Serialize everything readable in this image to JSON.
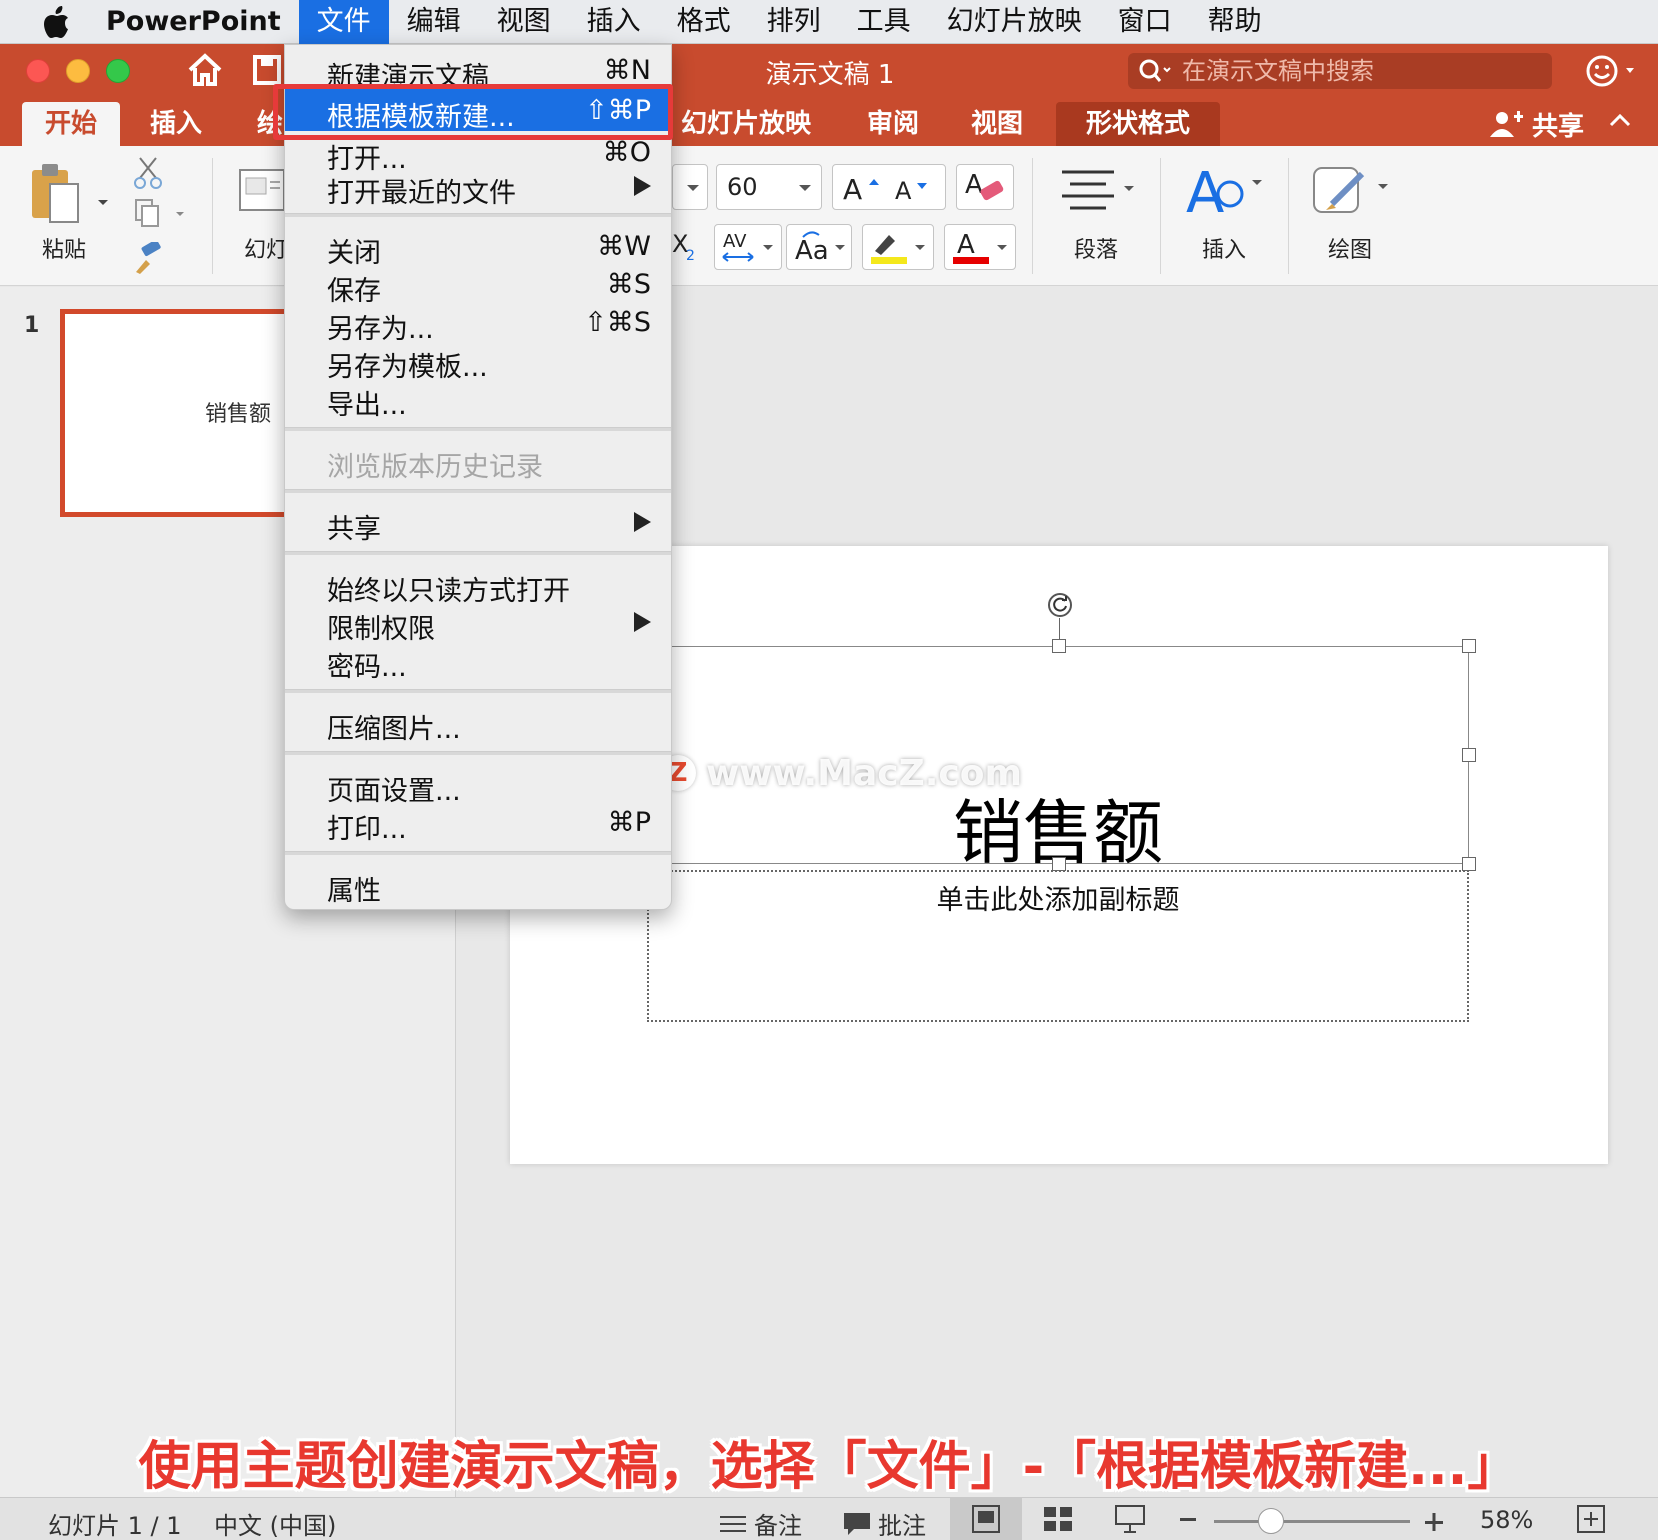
{
  "menubar": {
    "app": "PowerPoint",
    "items": [
      "文件",
      "编辑",
      "视图",
      "插入",
      "格式",
      "排列",
      "工具",
      "幻灯片放映",
      "窗口",
      "帮助"
    ]
  },
  "window": {
    "title": "演示文稿 1",
    "search_placeholder": "在演示文稿中搜索"
  },
  "tabs": {
    "home": "开始",
    "insert": "插入",
    "draw_partial": "绘",
    "slideshow": "幻灯片放映",
    "review": "审阅",
    "view": "视图",
    "shape_format": "形状格式",
    "share": "共享"
  },
  "ribbon": {
    "paste": "粘贴",
    "slides_partial": "幻灯",
    "font_size": "60",
    "paragraph": "段落",
    "insert": "插入",
    "drawing": "绘图"
  },
  "file_menu": {
    "new_presentation": {
      "label": "新建演示文稿",
      "shortcut": "⌘N"
    },
    "new_from_template": {
      "label": "根据模板新建...",
      "shortcut": "⇧⌘P"
    },
    "open": {
      "label": "打开...",
      "shortcut": "⌘O"
    },
    "open_recent": {
      "label": "打开最近的文件"
    },
    "close": {
      "label": "关闭",
      "shortcut": "⌘W"
    },
    "save": {
      "label": "保存",
      "shortcut": "⌘S"
    },
    "save_as": {
      "label": "另存为...",
      "shortcut": "⇧⌘S"
    },
    "save_as_template": {
      "label": "另存为模板..."
    },
    "export": {
      "label": "导出..."
    },
    "browse_history": {
      "label": "浏览版本历史记录"
    },
    "share": {
      "label": "共享"
    },
    "always_read_only": {
      "label": "始终以只读方式打开"
    },
    "restrict": {
      "label": "限制权限"
    },
    "password": {
      "label": "密码..."
    },
    "compress": {
      "label": "压缩图片..."
    },
    "page_setup": {
      "label": "页面设置..."
    },
    "print": {
      "label": "打印...",
      "shortcut": "⌘P"
    },
    "properties": {
      "label": "属性"
    }
  },
  "slides_panel": {
    "number": "1",
    "thumb_title": "销售额"
  },
  "slide": {
    "title": "销售额",
    "subtitle_placeholder": "单击此处添加副标题"
  },
  "watermark": {
    "logo": "Z",
    "text": "www.MacZ.com"
  },
  "caption": "使用主题创建演示文稿，选择「文件」-「根据模板新建...」",
  "status": {
    "slide_count": "幻灯片 1 / 1",
    "language": "中文 (中国)",
    "notes": "备注",
    "comments": "批注",
    "zoom": "58%"
  }
}
